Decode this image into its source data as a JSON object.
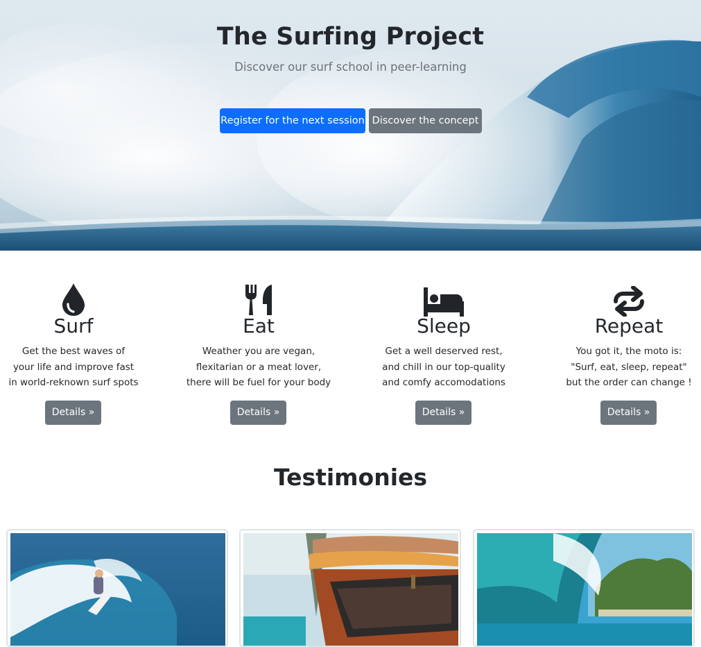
{
  "hero": {
    "title": "The Surfing Project",
    "subtitle": "Discover our surf school in peer-learning",
    "primary_button": "Register for the next session",
    "secondary_button": "Discover the concept"
  },
  "features": [
    {
      "icon": "water-drop-icon",
      "title": "Surf",
      "lines": [
        "Get the best waves of",
        "your life and improve fast",
        "in world-reknown surf spots"
      ],
      "button": "Details »"
    },
    {
      "icon": "fork-knife-icon",
      "title": "Eat",
      "lines": [
        "Weather you are vegan,",
        "flexitarian or a meat lover,",
        "there will be fuel for your body"
      ],
      "button": "Details »"
    },
    {
      "icon": "bed-icon",
      "title": "Sleep",
      "lines": [
        "Get a well deserved rest,",
        "and chill in our top-quality",
        "and comfy accomodations"
      ],
      "button": "Details »"
    },
    {
      "icon": "repeat-icon",
      "title": "Repeat",
      "lines": [
        "You got it, the moto is:",
        "\"Surf, eat, sleep, repeat\"",
        "but the order can change !"
      ],
      "button": "Details »"
    }
  ],
  "testimonies": {
    "title": "Testimonies",
    "cards": [
      {
        "image": "surfer-on-wave-photo"
      },
      {
        "image": "surfboards-on-van-photo"
      },
      {
        "image": "wave-barrel-photo"
      }
    ]
  },
  "colors": {
    "primary": "#0d6efd",
    "secondary": "#6c757d",
    "text": "#212529"
  }
}
